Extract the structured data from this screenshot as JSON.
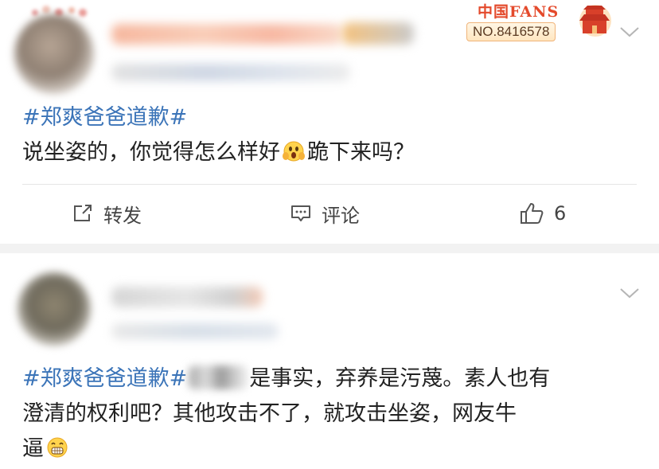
{
  "badge": {
    "title": "中国FANS",
    "number": "NO.8416578",
    "accent": "#e44a2c"
  },
  "post1": {
    "hashtag": "#郑爽爸爸道歉#",
    "text_before_emoji": "说坐姿的，你觉得怎么样好",
    "emoji": "shocked-face-emoji",
    "text_after_emoji": "跪下来吗？",
    "actions": {
      "repost_label": "转发",
      "comment_label": "评论",
      "like_count": "6"
    }
  },
  "post2": {
    "hashtag": "#郑爽爸爸道歉#",
    "line1_after_redaction": "是事实，弃养是污蔑。素人也有",
    "line2": "澄清的权利吧？其他攻击不了，就攻击坐姿，网友牛",
    "line3": "逼",
    "emoji": "grinning-face-emoji"
  },
  "colors": {
    "hashtag": "#3b74b8",
    "text": "#222222",
    "background": "#f2f2f2"
  }
}
